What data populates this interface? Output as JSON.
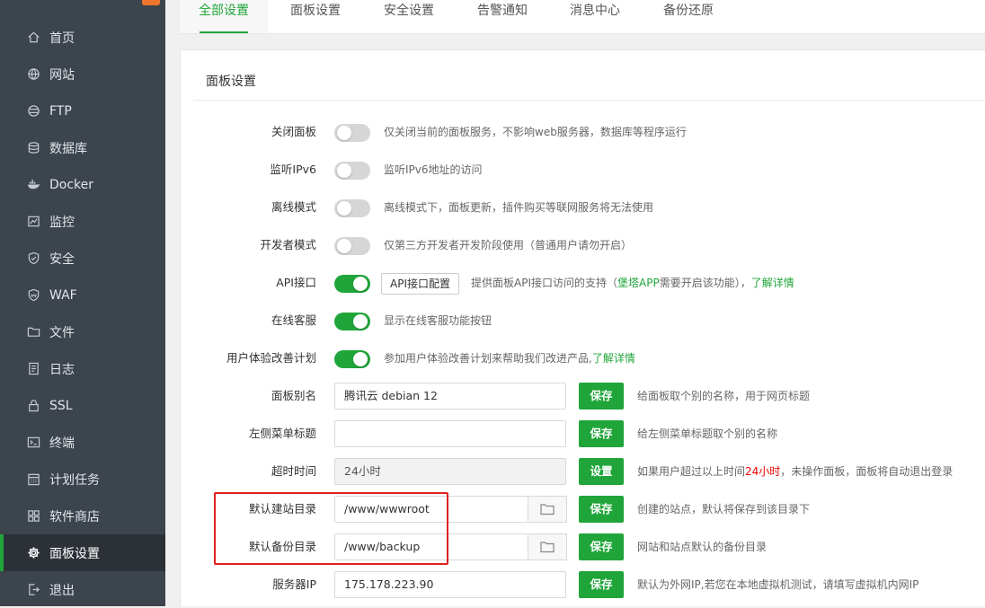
{
  "sidebar": {
    "items": [
      {
        "label": "首页",
        "icon": "home-icon"
      },
      {
        "label": "网站",
        "icon": "globe-icon"
      },
      {
        "label": "FTP",
        "icon": "ftp-icon"
      },
      {
        "label": "数据库",
        "icon": "database-icon"
      },
      {
        "label": "Docker",
        "icon": "docker-icon"
      },
      {
        "label": "监控",
        "icon": "monitor-icon"
      },
      {
        "label": "安全",
        "icon": "shield-icon"
      },
      {
        "label": "WAF",
        "icon": "waf-icon"
      },
      {
        "label": "文件",
        "icon": "folder-icon"
      },
      {
        "label": "日志",
        "icon": "log-icon"
      },
      {
        "label": "SSL",
        "icon": "ssl-icon"
      },
      {
        "label": "终端",
        "icon": "terminal-icon"
      },
      {
        "label": "计划任务",
        "icon": "calendar-icon"
      },
      {
        "label": "软件商店",
        "icon": "store-icon"
      },
      {
        "label": "面板设置",
        "icon": "gear-icon"
      },
      {
        "label": "退出",
        "icon": "logout-icon"
      }
    ],
    "active_index": 14
  },
  "tabs": [
    {
      "label": "全部设置"
    },
    {
      "label": "面板设置"
    },
    {
      "label": "安全设置"
    },
    {
      "label": "告警通知"
    },
    {
      "label": "消息中心"
    },
    {
      "label": "备份还原"
    }
  ],
  "panel": {
    "title": "面板设置",
    "close_panel": {
      "label": "关闭面板",
      "on": false,
      "desc": "仅关闭当前的面板服务，不影响web服务器，数据库等程序运行"
    },
    "ipv6": {
      "label": "监听IPv6",
      "on": false,
      "desc": "监听IPv6地址的访问"
    },
    "offline": {
      "label": "离线模式",
      "on": false,
      "desc": "离线模式下，面板更新，插件购买等联网服务将无法使用"
    },
    "developer": {
      "label": "开发者模式",
      "on": false,
      "desc": "仅第三方开发者开发阶段使用（普通用户请勿开启）"
    },
    "api": {
      "label": "API接口",
      "on": true,
      "button": "API接口配置",
      "desc_pre": "提供面板API接口访问的支持（",
      "desc_app": "堡塔APP",
      "desc_mid": "需要开启该功能），",
      "link": "了解详情"
    },
    "online_service": {
      "label": "在线客服",
      "on": true,
      "desc": "显示在线客服功能按钮"
    },
    "ux_plan": {
      "label": "用户体验改善计划",
      "on": true,
      "desc": "参加用户体验改善计划来帮助我们改进产品,",
      "link": "了解详情"
    },
    "alias": {
      "label": "面板别名",
      "value": "腾讯云 debian 12",
      "button": "保存",
      "desc": "给面板取个别的名称，用于网页标题"
    },
    "menu_title": {
      "label": "左侧菜单标题",
      "value": "",
      "button": "保存",
      "desc": "给左侧菜单标题取个别的名称"
    },
    "timeout": {
      "label": "超时时间",
      "value": "24小时",
      "button": "设置",
      "desc_pre": "如果用户超过以上时间",
      "desc_hl": "24小时",
      "desc_post": "，未操作面板，面板将自动退出登录"
    },
    "site_dir": {
      "label": "默认建站目录",
      "value": "/www/wwwroot",
      "button": "保存",
      "desc": "创建的站点，默认将保存到该目录下"
    },
    "backup_dir": {
      "label": "默认备份目录",
      "value": "/www/backup",
      "button": "保存",
      "desc": "网站和站点默认的备份目录"
    },
    "server_ip": {
      "label": "服务器IP",
      "value": "175.178.223.90",
      "button": "保存",
      "desc": "默认为外网IP,若您在本地虚拟机测试，请填写虚拟机内网IP"
    }
  },
  "colors": {
    "accent": "#20a53a",
    "sidebar_bg": "#3c444d",
    "highlight": "#e02020"
  }
}
